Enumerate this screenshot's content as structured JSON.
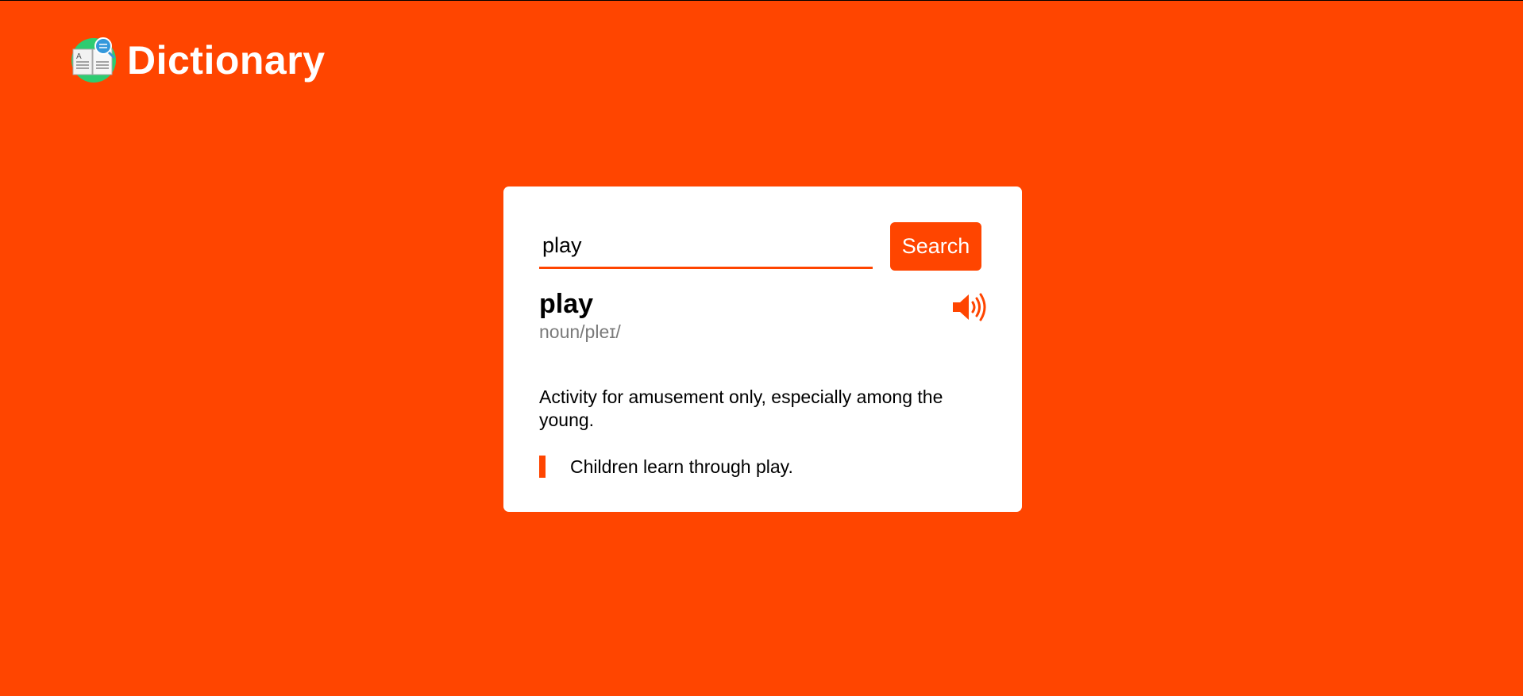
{
  "app": {
    "title": "Dictionary",
    "logo_icon": "dictionary-book-magnifier-icon"
  },
  "search": {
    "value": "play",
    "button_label": "Search"
  },
  "result": {
    "word": "play",
    "phonetic": "noun/pleɪ/",
    "definition": "Activity for amusement only, especially among the young.",
    "example": "Children learn through play.",
    "audio_icon": "speaker-icon"
  },
  "colors": {
    "accent": "#ff4500",
    "card": "#ffffff",
    "muted_text": "#7a7a7a"
  }
}
